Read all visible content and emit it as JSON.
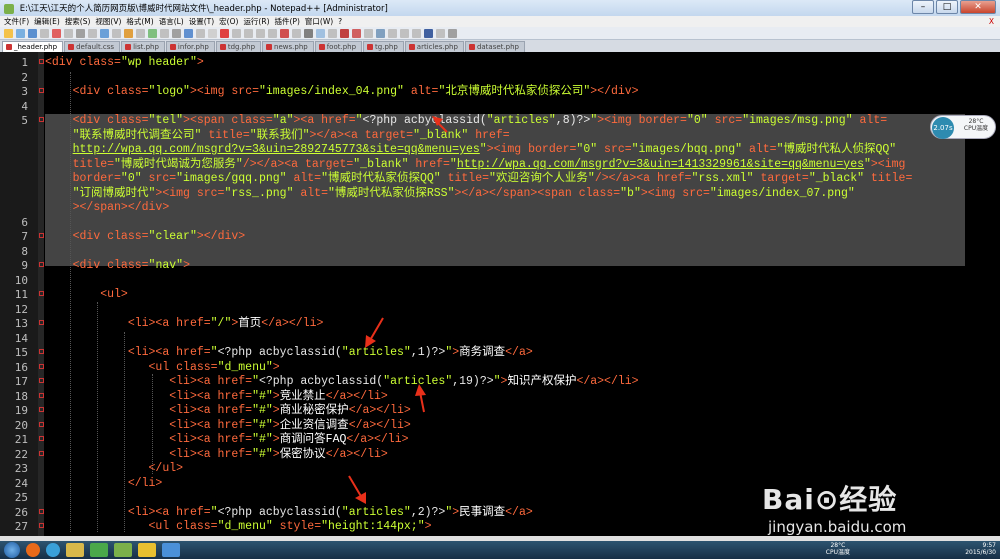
{
  "window": {
    "title": "E:\\江天\\江天的个人简历网页版\\博威时代网站文件\\_header.php - Notepad++ [Administrator]",
    "minimize": "–",
    "maximize": "□",
    "close": "✕"
  },
  "menu": [
    "文件(F)",
    "编辑(E)",
    "搜索(S)",
    "视图(V)",
    "格式(M)",
    "语言(L)",
    "设置(T)",
    "宏(O)",
    "运行(R)",
    "插件(P)",
    "窗口(W)",
    "?"
  ],
  "menu_close": "X",
  "tabs": [
    {
      "label": "_header.php",
      "active": true
    },
    {
      "label": "default.css",
      "active": false
    },
    {
      "label": "list.php",
      "active": false
    },
    {
      "label": "infor.php",
      "active": false
    },
    {
      "label": "tdg.php",
      "active": false
    },
    {
      "label": "news.php",
      "active": false
    },
    {
      "label": "foot.php",
      "active": false
    },
    {
      "label": "tg.php",
      "active": false
    },
    {
      "label": "articles.php",
      "active": false
    },
    {
      "label": "dataset.php",
      "active": false
    }
  ],
  "editor": {
    "lines": [
      {
        "n": "1",
        "code": [
          [
            "t",
            "<div "
          ],
          [
            "a",
            "class="
          ],
          [
            "v",
            "\"wp header\""
          ],
          [
            "t",
            ">"
          ]
        ]
      },
      {
        "n": "2",
        "code": []
      },
      {
        "n": "3",
        "code": [
          [
            "p",
            "    "
          ],
          [
            "t",
            "<div "
          ],
          [
            "a",
            "class="
          ],
          [
            "v",
            "\"logo\""
          ],
          [
            "t",
            "><img "
          ],
          [
            "a",
            "src="
          ],
          [
            "v",
            "\"images/index_04.png\""
          ],
          [
            "a",
            " alt="
          ],
          [
            "v",
            "\"北京博威时代私家侦探公司\""
          ],
          [
            "t",
            "></div>"
          ]
        ]
      },
      {
        "n": "4",
        "code": []
      },
      {
        "n": "5",
        "code": [
          [
            "p",
            "    "
          ],
          [
            "t",
            "<div "
          ],
          [
            "a",
            "class="
          ],
          [
            "v",
            "\"tel\""
          ],
          [
            "t",
            "><span "
          ],
          [
            "a",
            "class="
          ],
          [
            "v",
            "\"a\""
          ],
          [
            "t",
            "><a "
          ],
          [
            "a",
            "href="
          ],
          [
            "v",
            "\""
          ],
          [
            "p",
            "<?php acbyclassid("
          ],
          [
            "v",
            "\"articles\""
          ],
          [
            "p",
            ",8)?>"
          ],
          [
            "v",
            "\""
          ],
          [
            "t",
            "><img "
          ],
          [
            "a",
            "border="
          ],
          [
            "v",
            "\"0\""
          ],
          [
            "a",
            " src="
          ],
          [
            "v",
            "\"images/msg.png\""
          ],
          [
            "a",
            " alt="
          ]
        ]
      },
      {
        "n": "",
        "code": [
          [
            "p",
            "    "
          ],
          [
            "v",
            "\"联系博威时代调查公司\""
          ],
          [
            "a",
            " title="
          ],
          [
            "v",
            "\"联系我们\""
          ],
          [
            "t",
            "></a><a "
          ],
          [
            "a",
            "target="
          ],
          [
            "v",
            "\"_blank\""
          ],
          [
            "a",
            " href="
          ]
        ]
      },
      {
        "n": "",
        "code": [
          [
            "p",
            "    "
          ],
          [
            "u",
            "http://wpa.qq.com/msgrd?v=3&uin=2892745773&site=qq&menu=yes"
          ],
          [
            "v",
            "\""
          ],
          [
            "t",
            "><img "
          ],
          [
            "a",
            "border="
          ],
          [
            "v",
            "\"0\""
          ],
          [
            "a",
            " src="
          ],
          [
            "v",
            "\"images/bqq.png\""
          ],
          [
            "a",
            " alt="
          ],
          [
            "v",
            "\"博威时代私人侦探QQ\""
          ]
        ]
      },
      {
        "n": "",
        "code": [
          [
            "p",
            "    "
          ],
          [
            "a",
            "title="
          ],
          [
            "v",
            "\"博威时代竭诚为您服务\""
          ],
          [
            "t",
            "/></a><a "
          ],
          [
            "a",
            "target="
          ],
          [
            "v",
            "\"_blank\""
          ],
          [
            "a",
            " href="
          ],
          [
            "v",
            "\""
          ],
          [
            "u",
            "http://wpa.qq.com/msgrd?v=3&uin=1413329961&site=qq&menu=yes"
          ],
          [
            "v",
            "\""
          ],
          [
            "t",
            "><img"
          ]
        ]
      },
      {
        "n": "",
        "code": [
          [
            "p",
            "    "
          ],
          [
            "a",
            "border="
          ],
          [
            "v",
            "\"0\""
          ],
          [
            "a",
            " src="
          ],
          [
            "v",
            "\"images/gqq.png\""
          ],
          [
            "a",
            " alt="
          ],
          [
            "v",
            "\"博威时代私家侦探QQ\""
          ],
          [
            "a",
            " title="
          ],
          [
            "v",
            "\"欢迎咨询个人业务\""
          ],
          [
            "t",
            "/></a><a "
          ],
          [
            "a",
            "href="
          ],
          [
            "v",
            "\"rss.xml\""
          ],
          [
            "a",
            " target="
          ],
          [
            "v",
            "\"_black\""
          ],
          [
            "a",
            " title="
          ]
        ]
      },
      {
        "n": "",
        "code": [
          [
            "p",
            "    "
          ],
          [
            "v",
            "\"订阅博威时代\""
          ],
          [
            "t",
            "><img "
          ],
          [
            "a",
            "src="
          ],
          [
            "v",
            "\"rss_.png\""
          ],
          [
            "a",
            " alt="
          ],
          [
            "v",
            "\"博威时代私家侦探RSS\""
          ],
          [
            "t",
            "></a></span><span "
          ],
          [
            "a",
            "class="
          ],
          [
            "v",
            "\"b\""
          ],
          [
            "t",
            "><img "
          ],
          [
            "a",
            "src="
          ],
          [
            "v",
            "\"images/index_07.png\""
          ]
        ]
      },
      {
        "n": "",
        "code": [
          [
            "p",
            "    "
          ],
          [
            "t",
            "></span></div>"
          ]
        ]
      },
      {
        "n": "6",
        "code": []
      },
      {
        "n": "7",
        "code": [
          [
            "p",
            "    "
          ],
          [
            "t",
            "<div "
          ],
          [
            "a",
            "class="
          ],
          [
            "v",
            "\"clear\""
          ],
          [
            "t",
            "></div>"
          ]
        ]
      },
      {
        "n": "8",
        "code": []
      },
      {
        "n": "9",
        "code": [
          [
            "p",
            "    "
          ],
          [
            "t",
            "<div "
          ],
          [
            "a",
            "class="
          ],
          [
            "v",
            "\"nav\""
          ],
          [
            "t",
            ">"
          ]
        ]
      },
      {
        "n": "10",
        "code": []
      },
      {
        "n": "11",
        "code": [
          [
            "p",
            "        "
          ],
          [
            "t",
            "<ul>"
          ]
        ]
      },
      {
        "n": "12",
        "code": []
      },
      {
        "n": "13",
        "code": [
          [
            "p",
            "            "
          ],
          [
            "t",
            "<li><a "
          ],
          [
            "a",
            "href="
          ],
          [
            "v",
            "\"/\""
          ],
          [
            "t",
            ">"
          ],
          [
            "tx",
            "首页"
          ],
          [
            "t",
            "</a></li>"
          ]
        ]
      },
      {
        "n": "14",
        "code": []
      },
      {
        "n": "15",
        "code": [
          [
            "p",
            "            "
          ],
          [
            "t",
            "<li><a "
          ],
          [
            "a",
            "href="
          ],
          [
            "v",
            "\""
          ],
          [
            "p",
            "<?php acbyclassid("
          ],
          [
            "v",
            "\"articles\""
          ],
          [
            "p",
            ",1)?>"
          ],
          [
            "v",
            "\""
          ],
          [
            "t",
            ">"
          ],
          [
            "tx",
            "商务调查"
          ],
          [
            "t",
            "</a>"
          ]
        ]
      },
      {
        "n": "16",
        "code": [
          [
            "p",
            "               "
          ],
          [
            "t",
            "<ul "
          ],
          [
            "a",
            "class="
          ],
          [
            "v",
            "\"d_menu\""
          ],
          [
            "t",
            ">"
          ]
        ]
      },
      {
        "n": "17",
        "code": [
          [
            "p",
            "                  "
          ],
          [
            "t",
            "<li><a "
          ],
          [
            "a",
            "href="
          ],
          [
            "v",
            "\""
          ],
          [
            "p",
            "<?php acbyclassid("
          ],
          [
            "v",
            "\"articles\""
          ],
          [
            "p",
            ",19)?>"
          ],
          [
            "v",
            "\""
          ],
          [
            "t",
            ">"
          ],
          [
            "tx",
            "知识产权保护"
          ],
          [
            "t",
            "</a></li>"
          ]
        ]
      },
      {
        "n": "18",
        "code": [
          [
            "p",
            "                  "
          ],
          [
            "t",
            "<li><a "
          ],
          [
            "a",
            "href="
          ],
          [
            "v",
            "\"#\""
          ],
          [
            "t",
            ">"
          ],
          [
            "tx",
            "竞业禁止"
          ],
          [
            "t",
            "</a></li>"
          ]
        ]
      },
      {
        "n": "19",
        "code": [
          [
            "p",
            "                  "
          ],
          [
            "t",
            "<li><a "
          ],
          [
            "a",
            "href="
          ],
          [
            "v",
            "\"#\""
          ],
          [
            "t",
            ">"
          ],
          [
            "tx",
            "商业秘密保护"
          ],
          [
            "t",
            "</a></li>"
          ]
        ]
      },
      {
        "n": "20",
        "code": [
          [
            "p",
            "                  "
          ],
          [
            "t",
            "<li><a "
          ],
          [
            "a",
            "href="
          ],
          [
            "v",
            "\"#\""
          ],
          [
            "t",
            ">"
          ],
          [
            "tx",
            "企业资信调查"
          ],
          [
            "t",
            "</a></li>"
          ]
        ]
      },
      {
        "n": "21",
        "code": [
          [
            "p",
            "                  "
          ],
          [
            "t",
            "<li><a "
          ],
          [
            "a",
            "href="
          ],
          [
            "v",
            "\"#\""
          ],
          [
            "t",
            ">"
          ],
          [
            "tx",
            "商调问答FAQ"
          ],
          [
            "t",
            "</a></li>"
          ]
        ]
      },
      {
        "n": "22",
        "code": [
          [
            "p",
            "                  "
          ],
          [
            "t",
            "<li><a "
          ],
          [
            "a",
            "href="
          ],
          [
            "v",
            "\"#\""
          ],
          [
            "t",
            ">"
          ],
          [
            "tx",
            "保密协议"
          ],
          [
            "t",
            "</a></li>"
          ]
        ]
      },
      {
        "n": "23",
        "code": [
          [
            "p",
            "               "
          ],
          [
            "t",
            "</ul>"
          ]
        ]
      },
      {
        "n": "24",
        "code": [
          [
            "p",
            "            "
          ],
          [
            "t",
            "</li>"
          ]
        ]
      },
      {
        "n": "25",
        "code": []
      },
      {
        "n": "26",
        "code": [
          [
            "p",
            "            "
          ],
          [
            "t",
            "<li><a "
          ],
          [
            "a",
            "href="
          ],
          [
            "v",
            "\""
          ],
          [
            "p",
            "<?php acbyclassid("
          ],
          [
            "v",
            "\"articles\""
          ],
          [
            "p",
            ",2)?>"
          ],
          [
            "v",
            "\""
          ],
          [
            "t",
            ">"
          ],
          [
            "tx",
            "民事调查"
          ],
          [
            "t",
            "</a>"
          ]
        ]
      },
      {
        "n": "27",
        "code": [
          [
            "p",
            "               "
          ],
          [
            "t",
            "<ul "
          ],
          [
            "a",
            "class="
          ],
          [
            "v",
            "\"d_menu\""
          ],
          [
            "a",
            " style="
          ],
          [
            "v",
            "\"height:144px;\""
          ],
          [
            "t",
            ">"
          ]
        ]
      }
    ]
  },
  "cpu_widget": {
    "value": "2.07s",
    "temp": "28°C",
    "label": "CPU温度"
  },
  "taskbar": {
    "temp": "28°C",
    "temp_label": "CPU温度",
    "time": "9:57",
    "date": "2015/6/30"
  },
  "watermark": {
    "logo": "Bai⊙经验",
    "site": "jingyan.baidu.com"
  },
  "colors": {
    "tag": "#ff6a3d",
    "value": "#ccff33",
    "php": "#e8e8e8",
    "selection": "#444444",
    "arrow": "#e8301a"
  }
}
